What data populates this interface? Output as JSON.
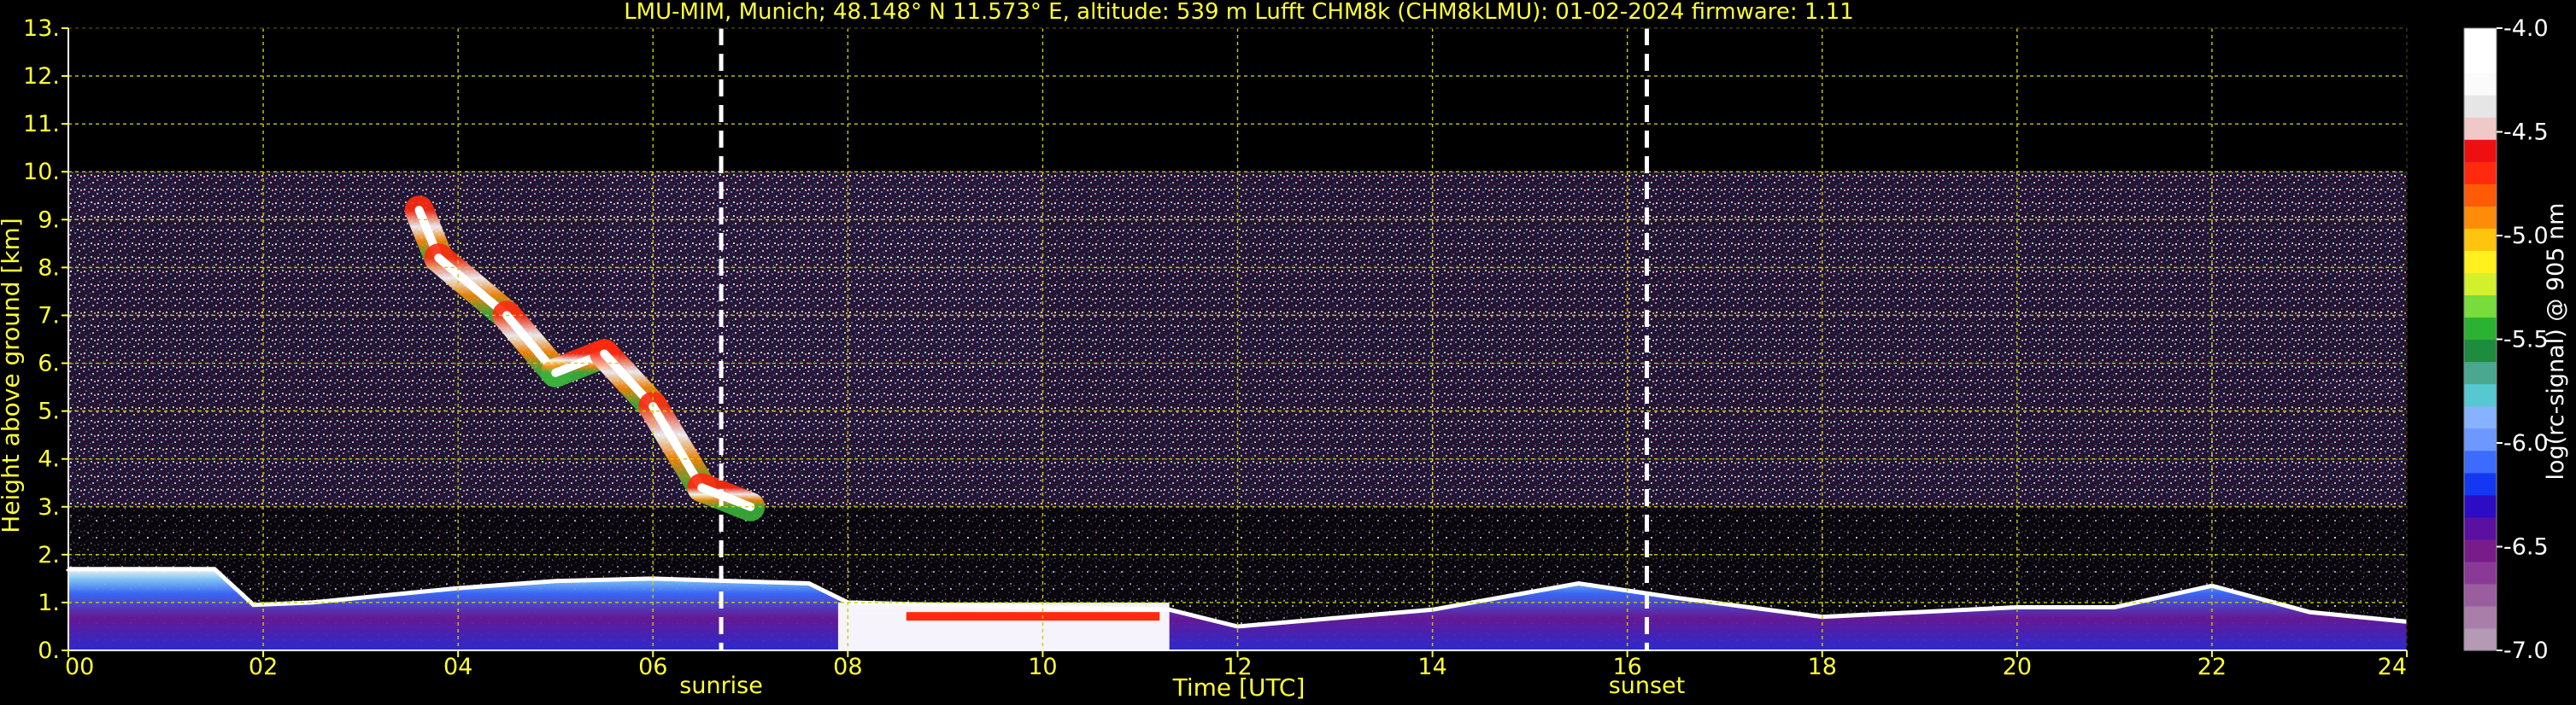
{
  "chart_data": {
    "type": "heatmap",
    "title": "LMU-MIM, Munich; 48.148° N 11.573° E, altitude: 539 m    Lufft CHM8k (CHM8kLMU): 01-02-2024    firmware: 1.11",
    "xlabel": "Time [UTC]",
    "ylabel": "Height above ground [km]",
    "xlim": [
      0,
      24
    ],
    "ylim": [
      0,
      13
    ],
    "x_ticks": [
      "00",
      "02",
      "04",
      "06",
      "08",
      "10",
      "12",
      "14",
      "16",
      "18",
      "20",
      "22",
      "24"
    ],
    "y_ticks": [
      "0.",
      "1.",
      "2.",
      "3.",
      "4.",
      "5.",
      "6.",
      "7.",
      "8.",
      "9.",
      "10.",
      "11.",
      "12.",
      "13."
    ],
    "grid": true,
    "events": [
      {
        "label": "sunrise",
        "time": 6.7
      },
      {
        "label": "sunset",
        "time": 16.2
      }
    ],
    "colorbar": {
      "label": "log(rc-signal) @ 905 nm",
      "range": [
        -7.0,
        -4.0
      ],
      "ticks": [
        "-4.0",
        "-4.5",
        "-5.0",
        "-5.5",
        "-6.0",
        "-6.5",
        "-7.0"
      ],
      "colors": [
        "#b59ab5",
        "#a97ea9",
        "#9a5e9e",
        "#8a3a96",
        "#781c8a",
        "#5a10a0",
        "#2c0cc4",
        "#1438f2",
        "#3c6cff",
        "#6c98ff",
        "#86b2ff",
        "#58c8d0",
        "#4aa890",
        "#1e8c3e",
        "#2cb232",
        "#78dc3a",
        "#d4f02c",
        "#fff01e",
        "#ffc410",
        "#ff8c08",
        "#ff5a06",
        "#ff2a0e",
        "#ee1010",
        "#f0c8c8",
        "#e6e6e6",
        "#fbfbfb",
        "#ffffff",
        "#ffffff"
      ]
    },
    "noise_top_km": 10.0,
    "boundary_layer": [
      {
        "t": 0.0,
        "h": 1.7
      },
      {
        "t": 1.5,
        "h": 1.7
      },
      {
        "t": 1.9,
        "h": 0.95
      },
      {
        "t": 2.5,
        "h": 1.0
      },
      {
        "t": 4.0,
        "h": 1.3
      },
      {
        "t": 5.0,
        "h": 1.45
      },
      {
        "t": 6.0,
        "h": 1.5
      },
      {
        "t": 6.8,
        "h": 1.45
      },
      {
        "t": 7.6,
        "h": 1.4
      },
      {
        "t": 8.0,
        "h": 1.0
      },
      {
        "t": 10.0,
        "h": 0.9
      },
      {
        "t": 11.3,
        "h": 0.85
      },
      {
        "t": 12.0,
        "h": 0.5
      },
      {
        "t": 14.0,
        "h": 0.85
      },
      {
        "t": 15.5,
        "h": 1.4
      },
      {
        "t": 16.5,
        "h": 1.1
      },
      {
        "t": 18.0,
        "h": 0.7
      },
      {
        "t": 20.0,
        "h": 0.9
      },
      {
        "t": 21.0,
        "h": 0.9
      },
      {
        "t": 22.0,
        "h": 1.35
      },
      {
        "t": 23.0,
        "h": 0.8
      },
      {
        "t": 24.0,
        "h": 0.6
      }
    ],
    "cloud_path": [
      {
        "t": 3.6,
        "h": 9.2
      },
      {
        "t": 3.8,
        "h": 8.2
      },
      {
        "t": 4.5,
        "h": 7.0
      },
      {
        "t": 5.0,
        "h": 5.8
      },
      {
        "t": 5.5,
        "h": 6.2
      },
      {
        "t": 6.0,
        "h": 5.1
      },
      {
        "t": 6.5,
        "h": 3.4
      },
      {
        "t": 7.0,
        "h": 3.0
      }
    ],
    "noise_bands": [
      {
        "t0": 5.5,
        "t1": 10.0,
        "h0": 4.5,
        "h1": 10.0
      },
      {
        "t0": 0.1,
        "t1": 1.1,
        "h0": 9.0,
        "h1": 9.9
      },
      {
        "t0": 23.1,
        "t1": 23.9,
        "h0": 5.4,
        "h1": 5.7
      }
    ]
  }
}
